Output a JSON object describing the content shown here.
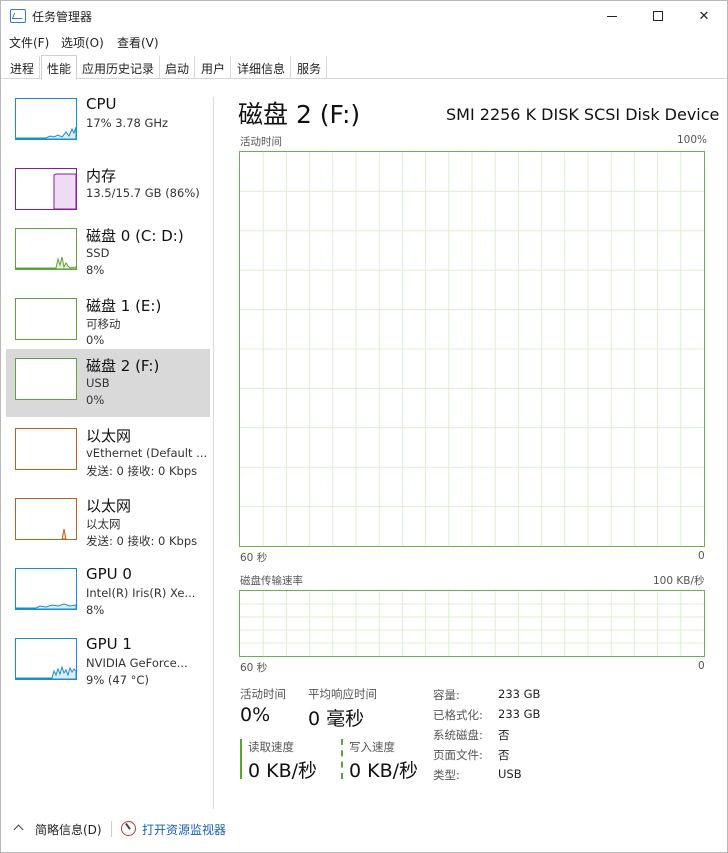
{
  "window": {
    "title": "任务管理器"
  },
  "menu": [
    "文件(F)",
    "选项(O)",
    "查看(V)"
  ],
  "tabs": [
    "进程",
    "性能",
    "应用历史记录",
    "启动",
    "用户",
    "详细信息",
    "服务"
  ],
  "active_tab": "性能",
  "sidebar": {
    "items": [
      {
        "name": "CPU",
        "line1": "17%  3.78 GHz",
        "line2": "",
        "color": "#1a8ecb",
        "selected": false
      },
      {
        "name": "内存",
        "line1": "13.5/15.7 GB (86%)",
        "line2": "",
        "color": "#8b1a9e",
        "selected": false
      },
      {
        "name": "磁盘 0 (C: D:)",
        "line1": "SSD",
        "line2": "8%",
        "color": "#5ea23a",
        "selected": false
      },
      {
        "name": "磁盘 1 (E:)",
        "line1": "可移动",
        "line2": "0%",
        "color": "#5ea23a",
        "selected": false
      },
      {
        "name": "磁盘 2 (F:)",
        "line1": "USB",
        "line2": "0%",
        "color": "#5ea23a",
        "selected": true
      },
      {
        "name": "以太网",
        "line1": "vEthernet (Default ...",
        "line2": "发送: 0  接收: 0 Kbps",
        "color": "#b5651d",
        "selected": false
      },
      {
        "name": "以太网",
        "line1": "以太网",
        "line2": "发送: 0  接收: 0 Kbps",
        "color": "#b5651d",
        "selected": false
      },
      {
        "name": "GPU 0",
        "line1": "Intel(R) Iris(R) Xe...",
        "line2": "8%",
        "color": "#1a8ecb",
        "selected": false
      },
      {
        "name": "GPU 1",
        "line1": "NVIDIA GeForce...",
        "line2": "9% (47 °C)",
        "color": "#1a8ecb",
        "selected": false
      }
    ]
  },
  "main": {
    "title": "磁盘 2 (F:)",
    "device": "SMI 2256 K DISK SCSI Disk Device",
    "activity_chart": {
      "label": "活动时间",
      "max": "100%",
      "time_label": "60 秒",
      "min": "0"
    },
    "transfer_chart": {
      "label": "磁盘传输速率",
      "max": "100 KB/秒",
      "time_label": "60 秒",
      "min": "0"
    },
    "stats": {
      "active_time_label": "活动时间",
      "active_time": "0%",
      "response_label": "平均响应时间",
      "response": "0 毫秒",
      "read_label": "读取速度",
      "read": "0 KB/秒",
      "write_label": "写入速度",
      "write": "0 KB/秒"
    },
    "info": [
      {
        "key": "容量:",
        "value": "233 GB"
      },
      {
        "key": "已格式化:",
        "value": "233 GB"
      },
      {
        "key": "系统磁盘:",
        "value": "否"
      },
      {
        "key": "页面文件:",
        "value": "否"
      },
      {
        "key": "类型:",
        "value": "USB"
      }
    ],
    "graph_color": "#5ea23a"
  },
  "footer": {
    "less_details": "简略信息(D)",
    "open_monitor": "打开资源监视器"
  }
}
